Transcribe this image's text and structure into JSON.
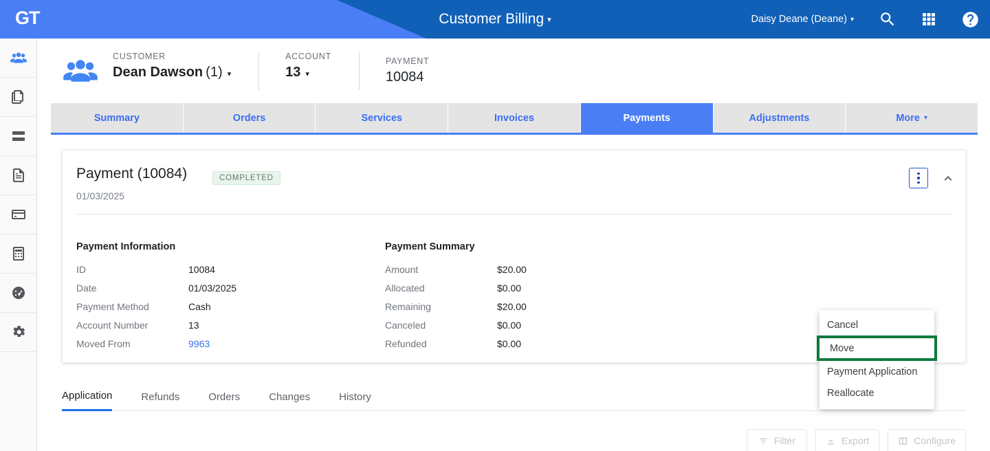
{
  "header": {
    "logo": "GT",
    "app_title": "Customer Billing",
    "app_title_caret": "▾",
    "user": "Daisy Deane (Deane)",
    "user_caret": "▾",
    "icons": [
      "search-icon",
      "apps-grid-icon",
      "help-icon"
    ],
    "bg_color": "#1160b7",
    "accent_color": "#4a7ef5"
  },
  "sidebar": {
    "items": [
      {
        "name": "customers",
        "active": true
      },
      {
        "name": "copies",
        "active": false
      },
      {
        "name": "servers",
        "active": false
      },
      {
        "name": "documents",
        "active": false
      },
      {
        "name": "payments-card",
        "active": false
      },
      {
        "name": "calculator",
        "active": false
      },
      {
        "name": "dashboard",
        "active": false
      },
      {
        "name": "settings",
        "active": false
      }
    ]
  },
  "context": {
    "customer": {
      "label": "CUSTOMER",
      "value": "Dean Dawson",
      "count": "(1)",
      "caret": "▾"
    },
    "account": {
      "label": "ACCOUNT",
      "value": "13",
      "caret": "▾"
    },
    "payment": {
      "label": "PAYMENT",
      "value": "10084"
    }
  },
  "tabs": [
    {
      "label": "Summary",
      "active": false
    },
    {
      "label": "Orders",
      "active": false
    },
    {
      "label": "Services",
      "active": false
    },
    {
      "label": "Invoices",
      "active": false
    },
    {
      "label": "Payments",
      "active": true
    },
    {
      "label": "Adjustments",
      "active": false
    },
    {
      "label": "More",
      "active": false,
      "caret": "▾"
    }
  ],
  "card": {
    "title": "Payment (10084)",
    "status_badge": "COMPLETED",
    "status_color": "#e8f5ec",
    "date": "01/03/2025",
    "kebab": "more-vertical-icon",
    "collapse": "chevron-up-icon",
    "payment_information": {
      "heading": "Payment Information",
      "rows": [
        {
          "key": "ID",
          "value": "10084",
          "link": false
        },
        {
          "key": "Date",
          "value": "01/03/2025",
          "link": false
        },
        {
          "key": "Payment Method",
          "value": "Cash",
          "link": false
        },
        {
          "key": "Account Number",
          "value": "13",
          "link": false
        },
        {
          "key": "Moved From",
          "value": "9963",
          "link": true
        }
      ]
    },
    "payment_summary": {
      "heading": "Payment Summary",
      "rows": [
        {
          "key": "Amount",
          "value": "$20.00"
        },
        {
          "key": "Allocated",
          "value": "$0.00"
        },
        {
          "key": "Remaining",
          "value": "$20.00"
        },
        {
          "key": "Canceled",
          "value": "$0.00"
        },
        {
          "key": "Refunded",
          "value": "$0.00"
        }
      ]
    }
  },
  "menu": {
    "items": [
      {
        "label": "Cancel",
        "highlighted": false
      },
      {
        "label": "Move",
        "highlighted": true
      },
      {
        "label": "Payment Application",
        "highlighted": false
      },
      {
        "label": "Reallocate",
        "highlighted": false
      }
    ],
    "highlight_color": "#0b7a3e"
  },
  "subtabs": [
    {
      "label": "Application",
      "active": true
    },
    {
      "label": "Refunds",
      "active": false
    },
    {
      "label": "Orders",
      "active": false
    },
    {
      "label": "Changes",
      "active": false
    },
    {
      "label": "History",
      "active": false
    }
  ],
  "toolbar": {
    "filter": "Filter",
    "export": "Export",
    "configure": "Configure"
  }
}
